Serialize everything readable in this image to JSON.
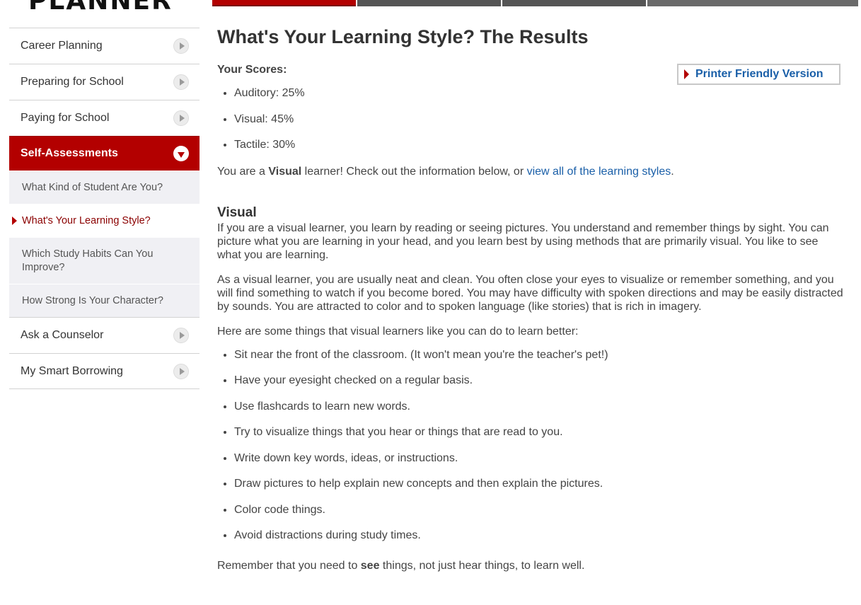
{
  "logo": {
    "text": "PLANNER",
    "mark": "®"
  },
  "sidebar": {
    "items": [
      {
        "label": "Career Planning"
      },
      {
        "label": "Preparing for School"
      },
      {
        "label": "Paying for School"
      },
      {
        "label": "Self-Assessments",
        "active": true
      },
      {
        "label": "Ask a Counselor"
      },
      {
        "label": "My Smart Borrowing"
      }
    ],
    "subitems": [
      {
        "label": "What Kind of Student Are You?"
      },
      {
        "label": "What's Your Learning Style?",
        "current": true
      },
      {
        "label": "Which Study Habits Can You Improve?"
      },
      {
        "label": "How Strong Is Your Character?"
      }
    ]
  },
  "main": {
    "title": "What's Your Learning Style? The Results",
    "scores_label": "Your Scores:",
    "print_button": "Printer Friendly Version",
    "scores": [
      "Auditory: 25%",
      "Visual: 45%",
      "Tactile: 30%"
    ],
    "result": {
      "prefix": "You are a ",
      "style": "Visual",
      "middle": " learner! Check out the information below, or ",
      "link": "view all of the learning styles",
      "suffix": "."
    },
    "section_title": "Visual",
    "paragraphs": [
      "If you are a visual learner, you learn by reading or seeing pictures. You understand and remember things by sight. You can picture what you are learning in your head, and you learn best by using methods that are primarily visual. You like to see what you are learning.",
      "As a visual learner, you are usually neat and clean. You often close your eyes to visualize or remember something, and you will find something to watch if you become bored. You may have difficulty with spoken directions and may be easily distracted by sounds. You are attracted to color and to spoken language (like stories) that is rich in imagery.",
      "Here are some things that visual learners like you can do to learn better:"
    ],
    "tips": [
      "Sit near the front of the classroom. (It won't mean you're the teacher's pet!)",
      "Have your eyesight checked on a regular basis.",
      "Use flashcards to learn new words.",
      "Try to visualize things that you hear or things that are read to you.",
      "Write down key words, ideas, or instructions.",
      "Draw pictures to help explain new concepts and then explain the pictures.",
      "Color code things.",
      "Avoid distractions during study times."
    ],
    "closing": {
      "prefix": "Remember that you need to ",
      "bold": "see",
      "suffix": " things, not just hear things, to learn well."
    }
  },
  "colors": {
    "accent": "#b30000",
    "link": "#1a5fa8",
    "subnav_bg": "#f0f0f4"
  }
}
